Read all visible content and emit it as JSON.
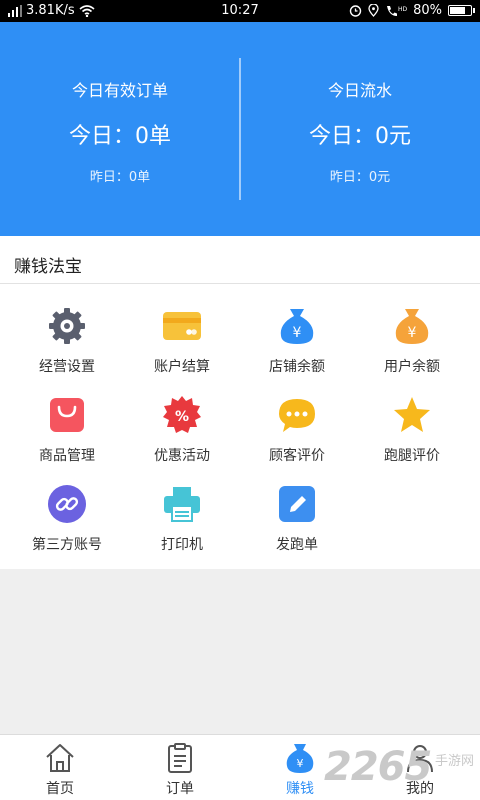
{
  "status_bar": {
    "speed": "3.81K/s",
    "time": "10:27",
    "battery": "80%",
    "battery_level": 0.8
  },
  "header": {
    "orders": {
      "title": "今日有效订单",
      "today": "今日：0单",
      "yesterday": "昨日：0单"
    },
    "revenue": {
      "title": "今日流水",
      "today": "今日：0元",
      "yesterday": "昨日：0元"
    }
  },
  "section": {
    "title": "赚钱法宝",
    "items": [
      {
        "label": "经营设置",
        "icon": "gear-icon"
      },
      {
        "label": "账户结算",
        "icon": "card-icon"
      },
      {
        "label": "店铺余额",
        "icon": "money-bag-icon"
      },
      {
        "label": "用户余额",
        "icon": "money-bag-orange-icon"
      },
      {
        "label": "商品管理",
        "icon": "shopping-bag-icon"
      },
      {
        "label": "优惠活动",
        "icon": "discount-badge-icon"
      },
      {
        "label": "顾客评价",
        "icon": "chat-bubble-icon"
      },
      {
        "label": "跑腿评价",
        "icon": "star-icon"
      },
      {
        "label": "第三方账号",
        "icon": "link-icon"
      },
      {
        "label": "打印机",
        "icon": "printer-icon"
      },
      {
        "label": "发跑单",
        "icon": "edit-icon"
      }
    ]
  },
  "tabbar": {
    "items": [
      {
        "label": "首页",
        "icon": "home-icon"
      },
      {
        "label": "订单",
        "icon": "clipboard-icon"
      },
      {
        "label": "赚钱",
        "icon": "money-bag-icon"
      },
      {
        "label": "我的",
        "icon": "user-icon"
      }
    ],
    "active": 2
  },
  "watermark": {
    "number": "2265",
    "text": "手游网"
  },
  "colors": {
    "primary": "#2f8ff5",
    "gear": "#5a5f6e",
    "card": "#f7c23a",
    "bag_blue": "#2f8ff5",
    "bag_orange": "#f5a33a",
    "shopping": "#f5555f",
    "discount": "#e8393e",
    "chat": "#f7b81c",
    "star": "#f7b81c",
    "link": "#6b62e0",
    "printer": "#46c4d6",
    "edit": "#3d8ff0"
  }
}
